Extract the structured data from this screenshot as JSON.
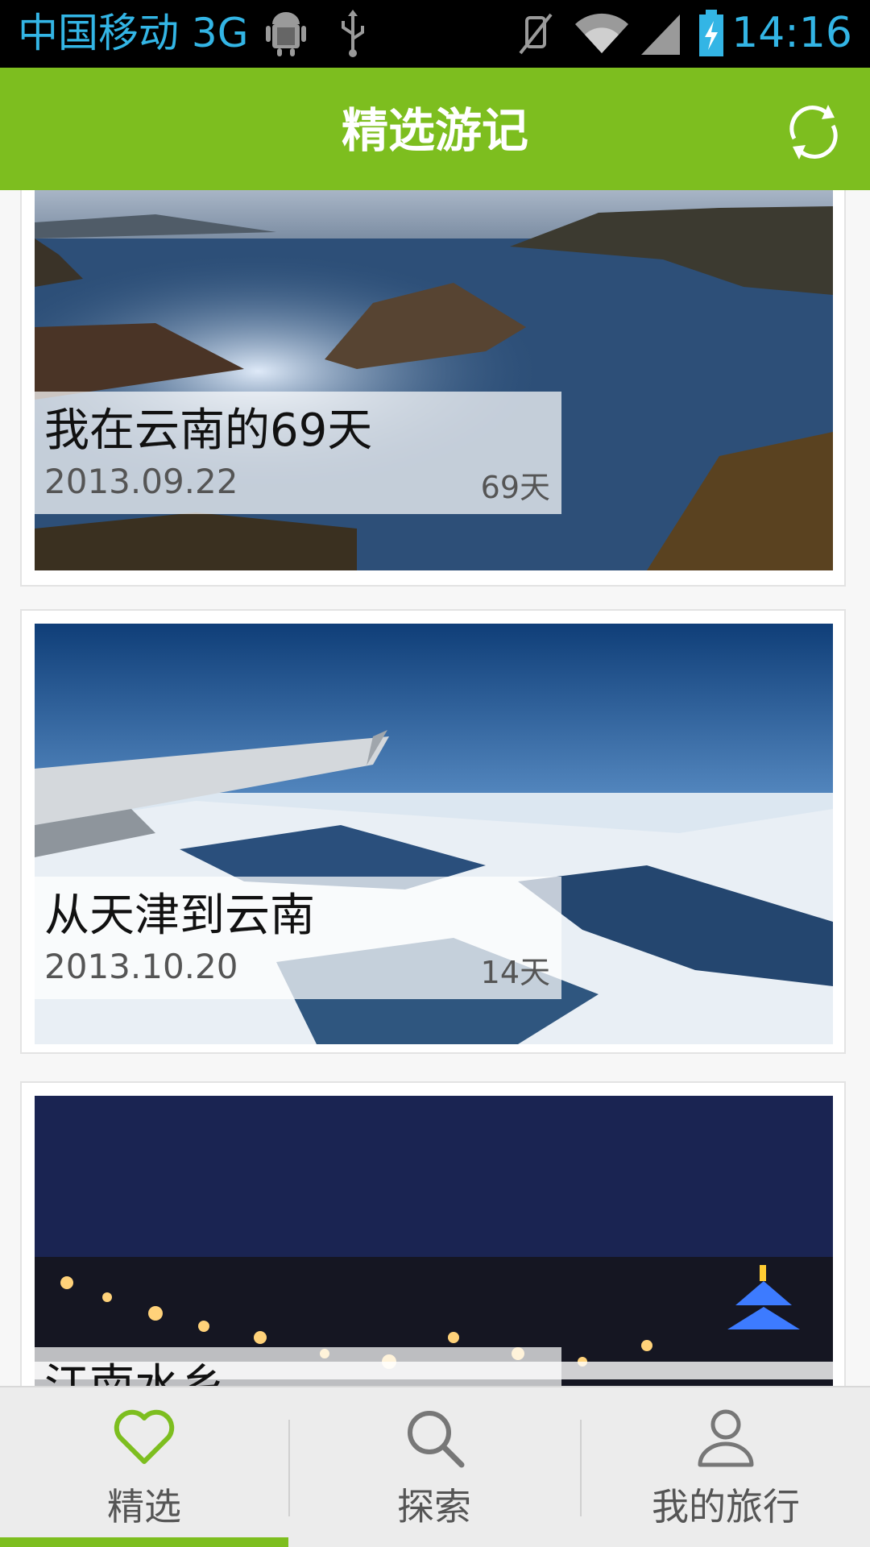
{
  "status_bar": {
    "carrier": "中国移动 3G",
    "time": "14:16",
    "icons": [
      "android-icon",
      "usb-icon",
      "mute-icon",
      "wifi-icon",
      "signal-icon",
      "battery-charging-icon"
    ]
  },
  "action_bar": {
    "title": "精选游记",
    "refresh_icon": "refresh-icon"
  },
  "feed": {
    "items": [
      {
        "title": "我在云南的69天",
        "date": "2013.09.22",
        "days": "69天"
      },
      {
        "title": "从天津到云南",
        "date": "2013.10.20",
        "days": "14天"
      },
      {
        "title": "江南水乡",
        "date": "",
        "days": ""
      }
    ]
  },
  "tab_bar": {
    "tabs": [
      {
        "label": "精选",
        "icon": "heart-icon",
        "active": true
      },
      {
        "label": "探索",
        "icon": "search-icon",
        "active": false
      },
      {
        "label": "我的旅行",
        "icon": "user-icon",
        "active": false
      }
    ]
  },
  "colors": {
    "accent": "#7dbe1f",
    "status_text": "#33b5e5",
    "status_bg": "#000000",
    "tab_bg": "#ececec"
  }
}
